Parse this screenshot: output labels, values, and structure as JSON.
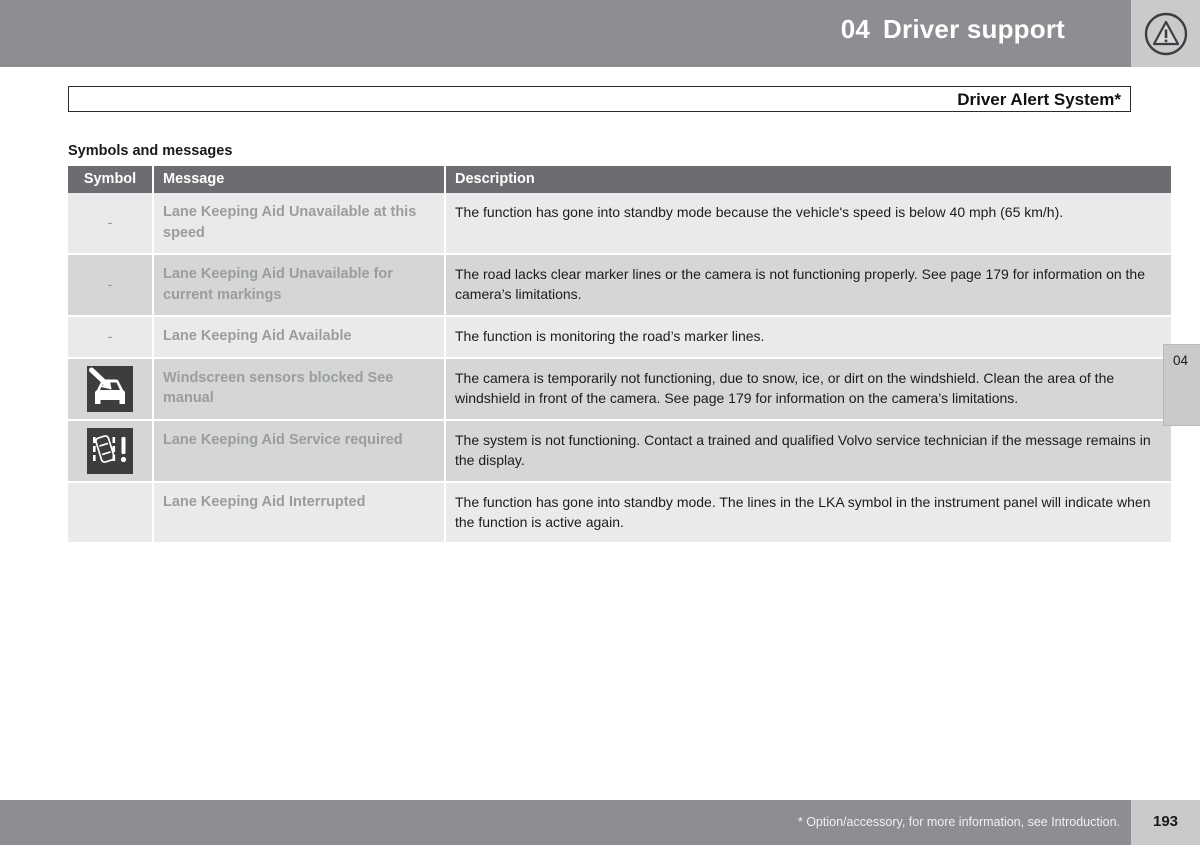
{
  "header": {
    "chapter_number": "04",
    "chapter_title": "Driver support",
    "warning_icon": "warning-triangle-icon",
    "band_color": "#8c8e91"
  },
  "title_box": {
    "text": "Driver Alert System*"
  },
  "section": {
    "heading": "Symbols and messages"
  },
  "table": {
    "columns": [
      {
        "key": "symbol",
        "label": "Symbol"
      },
      {
        "key": "message",
        "label": "Message"
      },
      {
        "key": "description",
        "label": "Description"
      }
    ],
    "header_bg": "#6b6d70",
    "row_bg_light": "#e9eaeb",
    "row_bg_dark": "#d4d6d7",
    "rows": [
      {
        "symbol": "-",
        "symbol_type": "dash",
        "message": "Lane Keeping Aid Unavailable at this speed",
        "description": "The function has gone into standby mode because the vehicle's speed is below 40 mph (65 km/h)."
      },
      {
        "symbol": "-",
        "symbol_type": "dash",
        "message": "Lane Keeping Aid Unavailable for current markings",
        "description": "The road lacks clear marker lines or the camera is not functioning properly. See page 179 for information on the camera’s limitations."
      },
      {
        "symbol": "-",
        "symbol_type": "dash",
        "message": "Lane Keeping Aid Available",
        "description": "The function is monitoring the road’s marker lines."
      },
      {
        "symbol": "windscreen-sensor-blocked-icon",
        "symbol_type": "icon",
        "message": "Windscreen sensors blocked See manual",
        "description": "The camera is temporarily not functioning, due to snow, ice, or dirt on the windshield. Clean the area of the windshield in front of the camera. See page 179 for information on the camera’s limitations."
      },
      {
        "symbol": "lane-keeping-aid-service-icon",
        "symbol_type": "icon",
        "message": "Lane Keeping Aid Service required",
        "description": "The system is not functioning. Contact a trained and qualified Volvo service technician if the message remains in the display."
      },
      {
        "symbol": "",
        "symbol_type": "empty",
        "message": "Lane Keeping Aid Interrupted",
        "description": "The function has gone into standby mode. The lines in the LKA symbol in the instrument panel will indicate when the function is active again."
      }
    ]
  },
  "side_tab": {
    "label": "04"
  },
  "footer": {
    "note": "* Option/accessory, for more information, see Introduction.",
    "page_number": "193"
  }
}
